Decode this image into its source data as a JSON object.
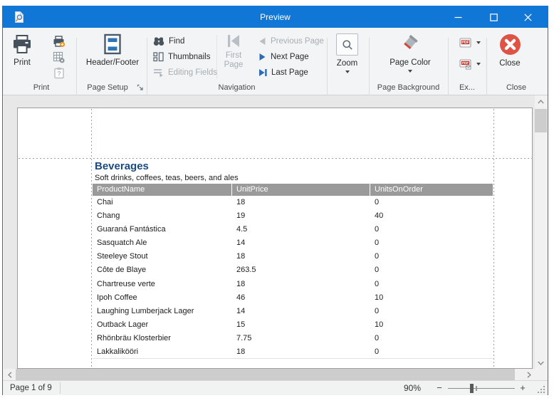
{
  "titlebar": {
    "title": "Preview"
  },
  "ribbon": {
    "groups": {
      "print": {
        "label": "Print",
        "print_button": "Print"
      },
      "page_setup": {
        "label": "Page Setup",
        "header_footer_button": "Header/Footer"
      },
      "navigation": {
        "label": "Navigation",
        "find": "Find",
        "thumbnails": "Thumbnails",
        "editing_fields": "Editing Fields",
        "first_page": "First Page",
        "previous_page": "Previous Page",
        "next_page": "Next Page",
        "last_page": "Last Page"
      },
      "zoom": {
        "zoom_button": "Zoom"
      },
      "page_background": {
        "label": "Page Background",
        "page_color_button": "Page Color"
      },
      "export": {
        "label": "Ex..."
      },
      "close": {
        "label": "Close",
        "close_button": "Close"
      }
    }
  },
  "document": {
    "title": "Beverages",
    "subtitle": "Soft drinks, coffees, teas, beers, and ales",
    "table": {
      "columns": [
        "ProductName",
        "UnitPrice",
        "UnitsOnOrder"
      ],
      "rows": [
        [
          "Chai",
          "18",
          "0"
        ],
        [
          "Chang",
          "19",
          "40"
        ],
        [
          "Guaraná Fantástica",
          "4.5",
          "0"
        ],
        [
          "Sasquatch Ale",
          "14",
          "0"
        ],
        [
          "Steeleye Stout",
          "18",
          "0"
        ],
        [
          "Côte de Blaye",
          "263.5",
          "0"
        ],
        [
          "Chartreuse verte",
          "18",
          "0"
        ],
        [
          "Ipoh Coffee",
          "46",
          "10"
        ],
        [
          "Laughing Lumberjack Lager",
          "14",
          "0"
        ],
        [
          "Outback Lager",
          "15",
          "10"
        ],
        [
          "Rhönbräu Klosterbier",
          "7.75",
          "0"
        ],
        [
          "Lakkalikööri",
          "18",
          "0"
        ]
      ]
    }
  },
  "statusbar": {
    "page_info": "Page 1 of 9",
    "zoom_level": "90%",
    "zoom_out": "−",
    "zoom_in": "+"
  },
  "icons": {
    "app": "preview-document-magnifier-icon",
    "titlebar": [
      "minimize-icon",
      "maximize-icon",
      "close-icon"
    ],
    "print_group": [
      "printer-icon",
      "printer-options-icon",
      "grid-options-icon",
      "clipboard-help-icon"
    ],
    "page_setup": [
      "header-footer-icon",
      "dialog-launcher-icon"
    ],
    "navigation": [
      "find-binoculars-icon",
      "thumbnails-icon",
      "editing-fields-icon",
      "first-page-icon",
      "previous-page-icon",
      "next-page-icon",
      "last-page-icon"
    ],
    "zoom": "magnifier-icon",
    "page_background": "paint-bucket-icon",
    "export": [
      "export-pdf-icon",
      "send-pdf-email-icon"
    ],
    "close": "close-circle-icon"
  },
  "colors": {
    "titlebar_blue": "#1177d7",
    "accent_blue": "#2d6cb5",
    "close_red": "#dd5345",
    "pdf_red": "#c23b2e",
    "table_header_bg": "#9a9a9a",
    "report_title_blue": "#1a4a80",
    "document_bg": "#e8e8e8"
  }
}
